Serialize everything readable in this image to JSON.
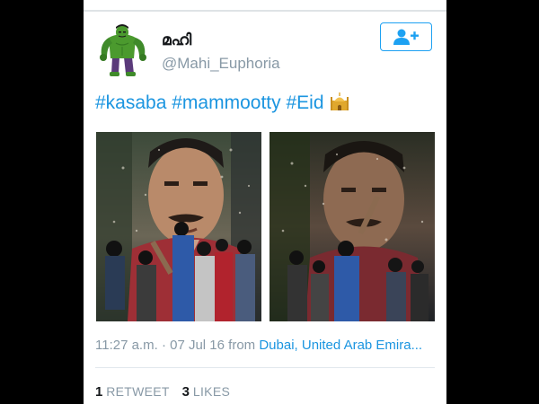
{
  "user": {
    "display_name": "മഹി",
    "handle": "@Mahi_Euphoria",
    "avatar": "hulk-avatar"
  },
  "follow_button": {
    "icon": "follow-user-plus-icon"
  },
  "tweet": {
    "hashtags": [
      "#kasaba",
      "#mammootty",
      "#Eid"
    ],
    "emoji_icon": "mosque-icon",
    "media": [
      "actor-poster-photo-1",
      "actor-poster-photo-2"
    ]
  },
  "meta": {
    "time": "11:27 a.m.",
    "separator": "·",
    "date": "07 Jul 16",
    "from_label": "from",
    "location": "Dubai, United Arab Emira..."
  },
  "stats": {
    "retweets_count": "1",
    "retweets_label": "RETWEET",
    "likes_count": "3",
    "likes_label": "LIKES"
  },
  "colors": {
    "link_blue": "#1b95e0",
    "follow_blue": "#1da1f2",
    "meta_gray": "#8899a6",
    "text_dark": "#14171a"
  }
}
